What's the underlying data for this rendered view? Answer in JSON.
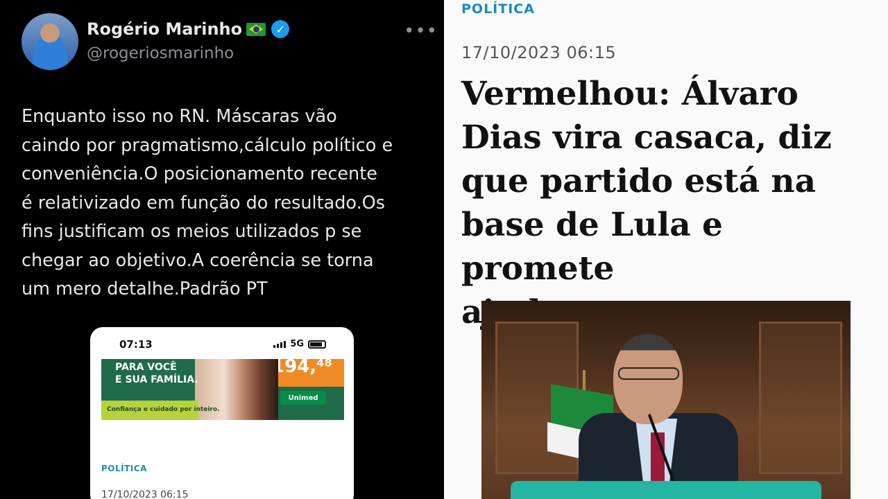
{
  "tweet": {
    "author_name": "Rogério Marinho",
    "handle": "@rogeriosmarinho",
    "verified_mark": "✓",
    "more_label": "•••",
    "text": "Enquanto isso no RN. Máscaras vão\ncaindo por pragmatismo,cálculo político e\nconveniência.O posicionamento recente\né relativizado em função do resultado.Os\nfins justificam os meios utilizados p se\nchegar ao objetivo.A coerência se torna\num mero detalhe.Padrão PT",
    "embedded_screenshot": {
      "time": "07:13",
      "network": "5G",
      "ad": {
        "price": "194,⁴⁸",
        "line1": "PARA VOCÊ",
        "line2": "E SUA FAMÍLIA.",
        "tagline": "Confiança e cuidado por inteiro.",
        "logo": "Unimed"
      },
      "category": "POLÍTICA",
      "date": "17/10/2023 06:15"
    }
  },
  "article": {
    "category": "POLÍTICA",
    "date": "17/10/2023 06:15",
    "headline": "Vermelhou: Álvaro\nDias vira casaca, diz\nque partido está na\nbase de Lula e promete\najudar governo"
  },
  "colors": {
    "category_blue": "#1a8ab8",
    "verified_blue": "#1d9bf0",
    "cta_teal": "#24b5a3"
  }
}
